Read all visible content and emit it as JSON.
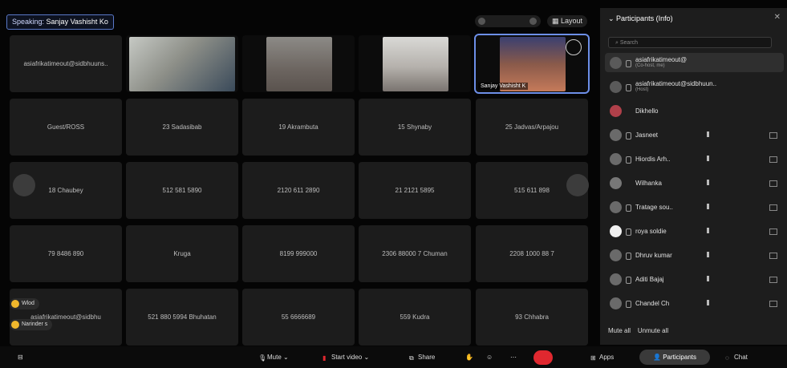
{
  "speaking": {
    "label": "Speaking:",
    "name": "Sanjay Vashisht Ko"
  },
  "view": {
    "layout_label": "Layout"
  },
  "tiles": [
    [
      "asiafrikatimeout@sidbhuuns..",
      "",
      "",
      "",
      "Sanjay Vashisht K"
    ],
    [
      "Guest/ROSS",
      "23 Sadasibab",
      "19 Akrambuta",
      "15 Shynaby",
      "25 Jadvas/Arpajou"
    ],
    [
      "18 Chaubey",
      "512 581 5890",
      "2120 611 2890",
      "21 2121 5895",
      "515 611 898"
    ],
    [
      "79 8486 890",
      "Kruga",
      "8199 999000",
      "2306 88000 7 Chuman",
      "2208 1000 88 7"
    ],
    [
      "asiafrikatimeout@sidbhu",
      "521 880 5994 Bhuhatan",
      "55 6666689",
      "559 Kudra",
      "93 Chhabra"
    ]
  ],
  "reactions": [
    {
      "label": "Wlod"
    },
    {
      "label": "Narinder s"
    }
  ],
  "bottom": {
    "mute": "Mute",
    "video": "Start video",
    "share": "Share",
    "apps": "Apps",
    "participants": "Participants",
    "chat": "Chat"
  },
  "panel": {
    "title": "Participants (Info)",
    "close": "✕",
    "search_placeholder": "Search",
    "participants": [
      {
        "name": "asiafrikatimeout@",
        "sub": "(Co-host, me)",
        "selected": true,
        "has_mark": false
      },
      {
        "name": "asiafrikatimeout@sidbhuun..",
        "sub": "(Host)",
        "selected": false,
        "has_mark": false
      },
      {
        "name": "Dikhello",
        "sub": "",
        "selected": false,
        "has_mark": false
      },
      {
        "name": "Jasneet",
        "sub": "",
        "selected": false,
        "has_mark": true
      },
      {
        "name": "Hiordis Arh..",
        "sub": "",
        "selected": false,
        "has_mark": true
      },
      {
        "name": "Wilhanka",
        "sub": "",
        "selected": false,
        "has_mark": true
      },
      {
        "name": "Tratage sou..",
        "sub": "",
        "selected": false,
        "has_mark": true
      },
      {
        "name": "roya soldie",
        "sub": "",
        "selected": false,
        "has_mark": true
      },
      {
        "name": "Dhruv kumar",
        "sub": "",
        "selected": false,
        "has_mark": true
      },
      {
        "name": "Aditi Bajaj",
        "sub": "",
        "selected": false,
        "has_mark": true
      },
      {
        "name": "Chandel Ch",
        "sub": "",
        "selected": false,
        "has_mark": true
      }
    ],
    "footer": {
      "mute_all": "Mute all",
      "unmute_all": "Unmute all"
    }
  },
  "colors": {
    "accent": "#6d8fe8",
    "end": "#e0282f",
    "tile": "#1c1c1c"
  }
}
